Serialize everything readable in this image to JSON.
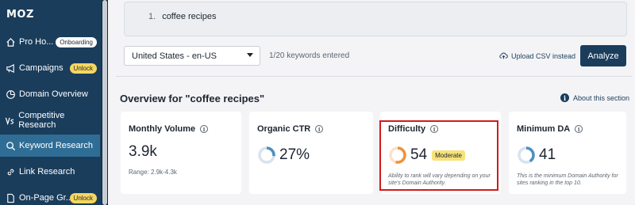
{
  "sidebar": {
    "logo": "MOZ",
    "items": [
      {
        "label": "Pro Ho...",
        "icon": "home-icon",
        "badge": "Onboarding"
      },
      {
        "label": "Campaigns",
        "icon": "megaphone-icon",
        "badge": "Unlock"
      },
      {
        "label": "Domain Overview",
        "icon": "pie-chart-icon",
        "badge": ""
      },
      {
        "label": "Competitive Research",
        "icon": "versus-icon",
        "badge": ""
      },
      {
        "label": "Keyword Research",
        "icon": "search-icon",
        "badge": ""
      },
      {
        "label": "Link Research",
        "icon": "link-icon",
        "badge": ""
      },
      {
        "label": "On-Page Gr...",
        "icon": "document-icon",
        "badge": "Unlock"
      }
    ]
  },
  "keyword_input": {
    "line_number": "1.",
    "value": "coffee recipes"
  },
  "controls": {
    "locale": "United States - en-US",
    "keyword_count": "1/20 keywords entered",
    "upload_label": "Upload CSV instead",
    "analyze_label": "Analyze"
  },
  "overview": {
    "title": "Overview for \"coffee recipes\"",
    "about_label": "About this section"
  },
  "cards": {
    "monthly_volume": {
      "title": "Monthly Volume",
      "value": "3.9k",
      "range": "Range: 2.9k-4.3k"
    },
    "organic_ctr": {
      "title": "Organic CTR",
      "value": "27%",
      "gauge_fraction": 0.27
    },
    "difficulty": {
      "title": "Difficulty",
      "value": "54",
      "label": "Moderate",
      "note": "Ability to rank will vary depending on your site's Domain Authority.",
      "gauge_fraction": 0.54
    },
    "minimum_da": {
      "title": "Minimum DA",
      "value": "41",
      "note": "This is the minimum Domain Authority for sites ranking in the top 10.",
      "gauge_fraction": 0.41
    }
  },
  "colors": {
    "sidebar_bg": "#1a3d5c",
    "active_item": "#2f6d95",
    "gauge_blue": "#4a90c2",
    "gauge_orange": "#f0923a",
    "highlight": "#d11b1b"
  }
}
